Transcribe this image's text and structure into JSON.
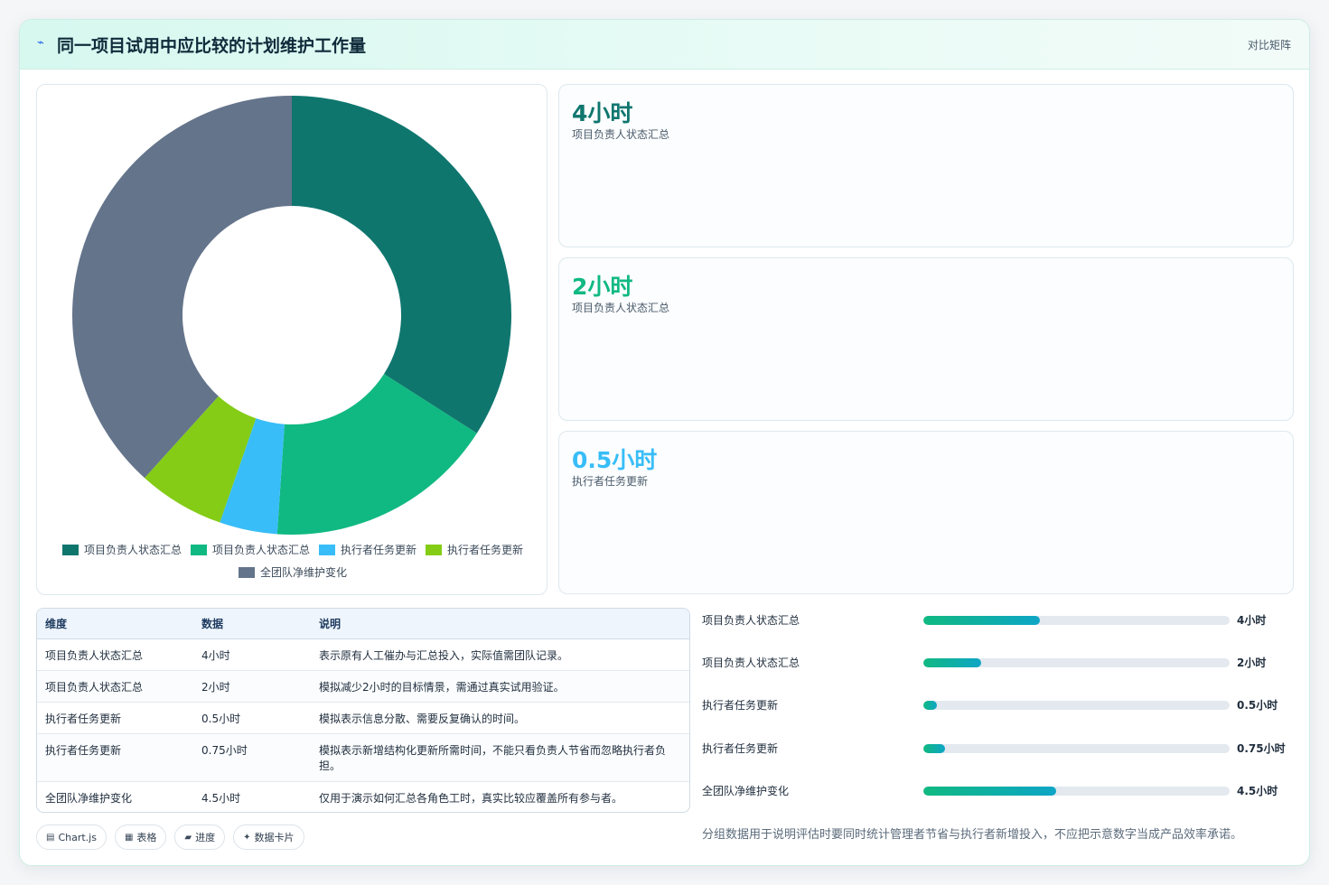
{
  "header": {
    "title": "同一项目试用中应比较的计划维护工作量",
    "icon": "chart-trend-icon",
    "link_label": "对比矩阵"
  },
  "chart_data": {
    "type": "pie",
    "donut": true,
    "categories": [
      "项目负责人状态汇总",
      "项目负责人状态汇总",
      "执行者任务更新",
      "执行者任务更新",
      "全团队净维护变化"
    ],
    "values": [
      4,
      2,
      0.5,
      0.75,
      4.5
    ],
    "colors": [
      "#0f766e",
      "#10b981",
      "#38bdf8",
      "#84cc16",
      "#64748b"
    ],
    "legend_position": "bottom"
  },
  "stats": [
    {
      "value": "4小时",
      "label": "项目负责人状态汇总",
      "color": "#0f766e"
    },
    {
      "value": "2小时",
      "label": "项目负责人状态汇总",
      "color": "#10b981"
    },
    {
      "value": "0.5小时",
      "label": "执行者任务更新",
      "color": "#38bdf8"
    }
  ],
  "table": {
    "headers": [
      "维度",
      "数据",
      "说明"
    ],
    "rows": [
      [
        "项目负责人状态汇总",
        "4小时",
        "表示原有人工催办与汇总投入，实际值需团队记录。"
      ],
      [
        "项目负责人状态汇总",
        "2小时",
        "模拟减少2小时的目标情景，需通过真实试用验证。"
      ],
      [
        "执行者任务更新",
        "0.5小时",
        "模拟表示信息分散、需要反复确认的时间。"
      ],
      [
        "执行者任务更新",
        "0.75小时",
        "模拟表示新增结构化更新所需时间，不能只看负责人节省而忽略执行者负担。"
      ],
      [
        "全团队净维护变化",
        "4.5小时",
        "仅用于演示如何汇总各角色工时，真实比较应覆盖所有参与者。"
      ]
    ]
  },
  "chips": [
    {
      "icon": "chart-icon",
      "glyph": "▤",
      "label": "Chart.js"
    },
    {
      "icon": "table-icon",
      "glyph": "▦",
      "label": "表格"
    },
    {
      "icon": "progress-icon",
      "glyph": "▰",
      "label": "进度"
    },
    {
      "icon": "sparkle-icon",
      "glyph": "✦",
      "label": "数据卡片"
    }
  ],
  "bars": [
    {
      "label": "项目负责人状态汇总",
      "value": "4小时",
      "fraction": 0.38
    },
    {
      "label": "项目负责人状态汇总",
      "value": "2小时",
      "fraction": 0.19
    },
    {
      "label": "执行者任务更新",
      "value": "0.5小时",
      "fraction": 0.045
    },
    {
      "label": "执行者任务更新",
      "value": "0.75小时",
      "fraction": 0.07
    },
    {
      "label": "全团队净维护变化",
      "value": "4.5小时",
      "fraction": 0.435
    }
  ],
  "footnote": "分组数据用于说明评估时要同时统计管理者节省与执行者新增投入，不应把示意数字当成产品效率承诺。"
}
